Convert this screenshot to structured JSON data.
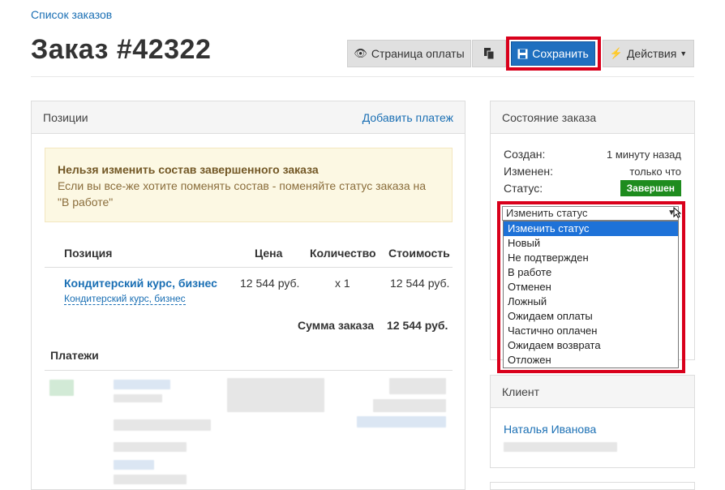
{
  "breadcrumb": {
    "label": "Список заказов"
  },
  "page": {
    "title": "Заказ #42322"
  },
  "toolbar": {
    "pay_page_label": "Страница оплаты",
    "save_label": "Сохранить",
    "actions_label": "Действия"
  },
  "positions_panel": {
    "title": "Позиции",
    "add_payment_label": "Добавить платеж",
    "alert": {
      "title": "Нельзя изменить состав завершенного заказа",
      "text": "Если вы все-же хотите поменять состав - поменяйте статус заказа на \"В работе\""
    },
    "columns": [
      "Позиция",
      "Цена",
      "Количество",
      "Стоимость"
    ],
    "rows": [
      {
        "name": "Кондитерский курс, бизнес",
        "sub": "Кондитерский курс, бизнес",
        "price": "12 544 руб.",
        "qty": "x 1",
        "cost": "12 544 руб."
      }
    ],
    "total_label": "Сумма заказа",
    "total_value": "12 544 руб.",
    "payments_title": "Платежи"
  },
  "status_panel": {
    "title": "Состояние заказа",
    "created_label": "Создан:",
    "created_value": "1 минуту назад",
    "changed_label": "Изменен:",
    "changed_value": "только что",
    "status_label": "Статус:",
    "status_value": "Завершен",
    "status_color": "#1e8c1e",
    "select_value": "Изменить статус",
    "options": [
      "Изменить статус",
      "Новый",
      "Не подтвержден",
      "В работе",
      "Отменен",
      "Ложный",
      "Ожидаем оплаты",
      "Частично оплачен",
      "Ожидаем возврата",
      "Отложен"
    ]
  },
  "client_panel": {
    "title": "Клиент",
    "name": "Наталья Иванова"
  },
  "colors": {
    "accent": "#1a6fb4",
    "save_button": "#1f6fbf",
    "highlight": "#d9001b",
    "alert_bg": "#fcf8e3"
  }
}
